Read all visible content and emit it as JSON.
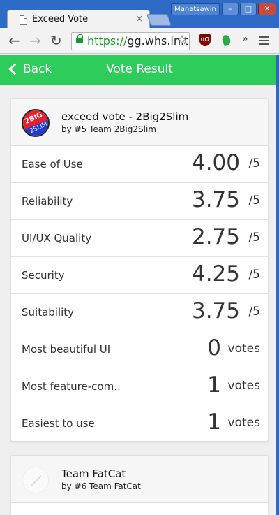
{
  "browser": {
    "tab_title": "Exceed Vote",
    "tab_close": "×",
    "profile_name": "Manatsawin",
    "url_scheme": "https://",
    "url_rest": "gg.whs.in.th/exceed-vote/result",
    "ext_label": "uO",
    "more": "»"
  },
  "appbar": {
    "back_label": "Back",
    "title": "Vote Result",
    "color": "#2ecc5a"
  },
  "cards": [
    {
      "title": "exceed vote - 2Big2Slim",
      "subtitle": "by #5 Team 2Big2Slim",
      "logo_text_1": "2BIG",
      "logo_text_2": "2SLIM",
      "rows": [
        {
          "label": "Ease of Use",
          "value": "4.00",
          "unit": "/5"
        },
        {
          "label": "Reliability",
          "value": "3.75",
          "unit": "/5"
        },
        {
          "label": "UI/UX Quality",
          "value": "2.75",
          "unit": "/5"
        },
        {
          "label": "Security",
          "value": "4.25",
          "unit": "/5"
        },
        {
          "label": "Suitability",
          "value": "3.75",
          "unit": "/5"
        },
        {
          "label": "Most beautiful UI",
          "value": "0",
          "unit": "votes"
        },
        {
          "label": "Most feature-com..",
          "value": "1",
          "unit": "votes"
        },
        {
          "label": "Easiest to use",
          "value": "1",
          "unit": "votes"
        }
      ]
    },
    {
      "title": "Team FatCat",
      "subtitle": "by #6 Team FatCat"
    }
  ]
}
